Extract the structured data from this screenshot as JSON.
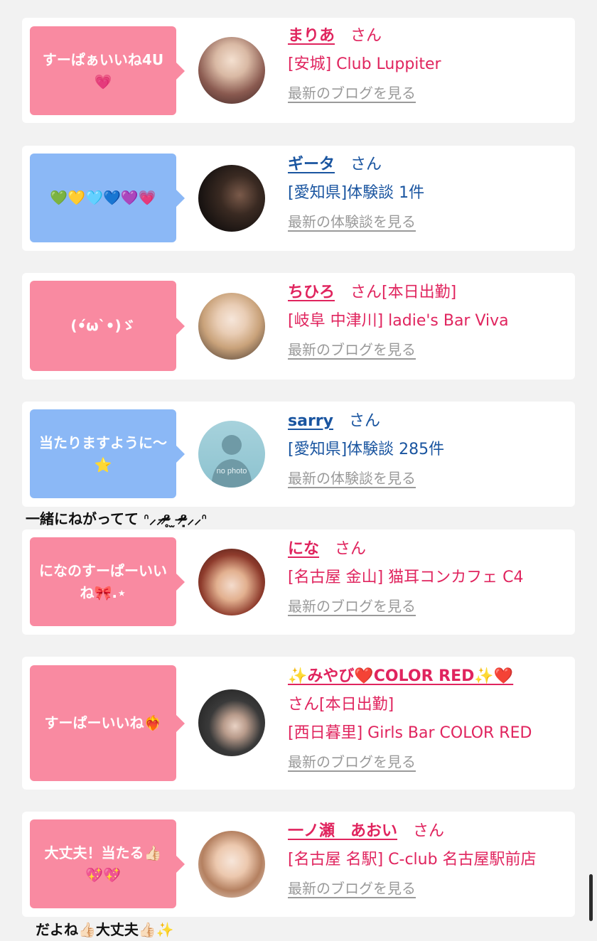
{
  "cards": [
    {
      "bubble": "すーぱぁいいね4U",
      "bubble_emoji": "💗",
      "bubble_color": "pink",
      "name": "まりあ",
      "honorific": "さん",
      "status": "",
      "location": "[安城] Club Luppiter",
      "link": "最新のブログを見る",
      "text_color": "pink"
    },
    {
      "bubble": "",
      "bubble_emoji": "💚💛🩵💙💜💗",
      "bubble_color": "blue",
      "name": "ギータ",
      "honorific": "さん",
      "status": "",
      "location": "[愛知県]体験談 1件",
      "link": "最新の体験談を見る",
      "text_color": "blue"
    },
    {
      "bubble": "(•́ω`•)ゞ",
      "bubble_emoji": "",
      "bubble_color": "pink",
      "name": "ちひろ",
      "honorific": "さん",
      "status": "[本日出勤]",
      "location": "[岐阜 中津川] ladie's Bar Viva",
      "link": "最新のブログを見る",
      "text_color": "pink"
    },
    {
      "bubble": "当たりますように〜",
      "bubble_emoji": "⭐",
      "bubble_color": "blue",
      "name": "sarry",
      "honorific": "さん",
      "status": "",
      "location": "[愛知県]体験談 285件",
      "link": "最新の体験談を見る",
      "text_color": "blue",
      "avatar_text": "no photo"
    },
    {
      "bubble": "になのすーぱーいいね🎀.⋆",
      "bubble_emoji": "",
      "bubble_color": "pink",
      "name": "にな",
      "honorific": "さん",
      "status": "",
      "location": "[名古屋 金山] 猫耳コンカフェ C4",
      "link": "最新のブログを見る",
      "text_color": "pink"
    },
    {
      "bubble": "すーぱーいいね",
      "bubble_emoji": "❤️‍🔥",
      "bubble_color": "pink",
      "name": "✨みやび❤️COLOR RED✨❤️",
      "honorific": "さん",
      "status": "[本日出勤]",
      "location": "[西日暮里] Girls Bar COLOR RED",
      "link": "最新のブログを見る",
      "text_color": "pink"
    },
    {
      "bubble": "大丈夫！当たる👍🏻",
      "bubble_emoji": "💖💖",
      "bubble_color": "pink",
      "name": "一ノ瀬　あおい",
      "honorific": "さん",
      "status": "",
      "location": "[名古屋 名駅] C-club 名古屋駅前店",
      "link": "最新のブログを見る",
      "text_color": "pink"
    }
  ],
  "between_text_1": "一緒にねがってて ᐢ⸝⸝ᵒ̴̶̷̥ ̫ ᵒ̴̶̷̣⸝⸝ᐢ",
  "between_text_2": "だよね👍🏻大丈夫👍🏻✨"
}
